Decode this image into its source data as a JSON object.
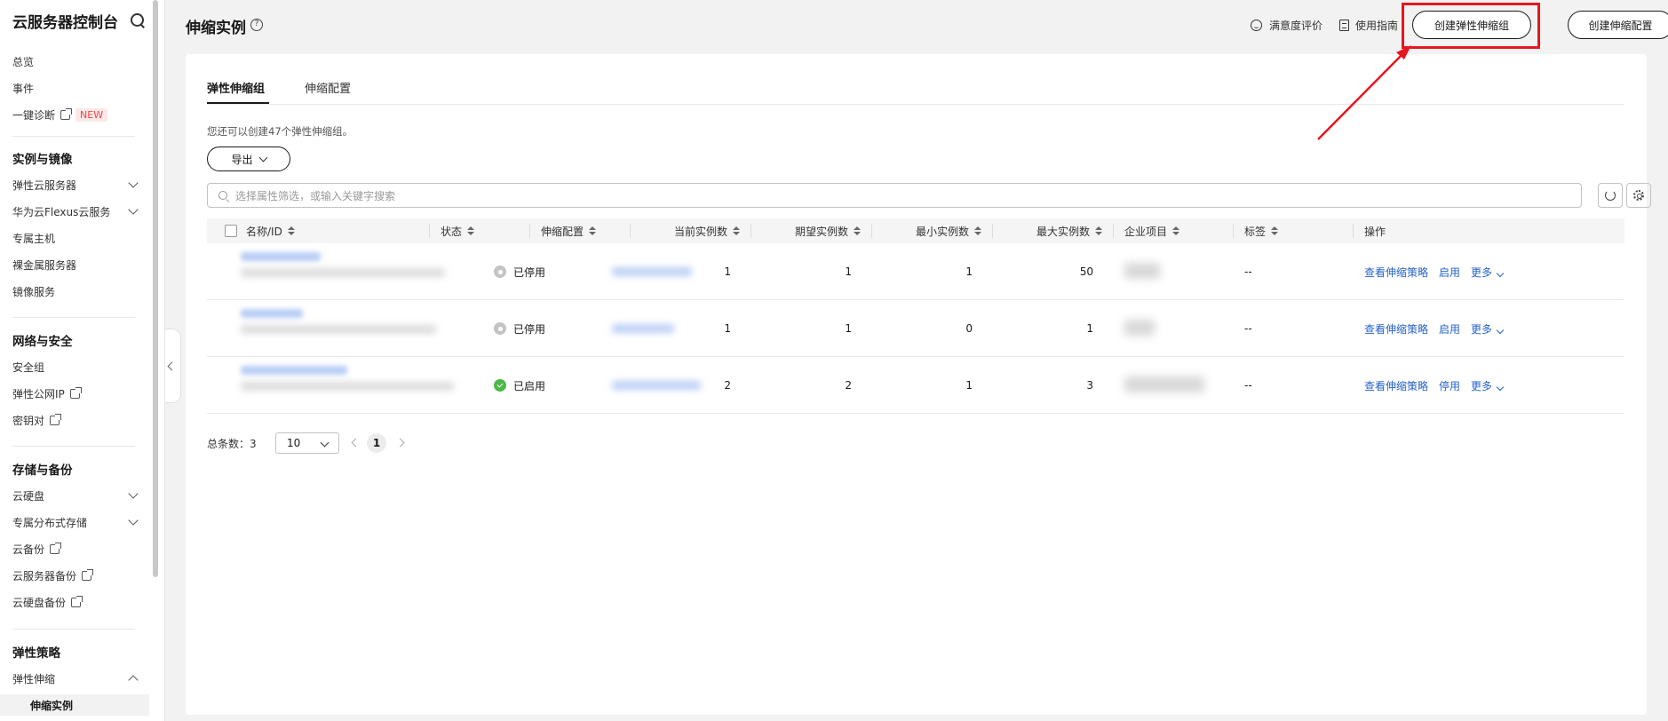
{
  "sidebar": {
    "title": "云服务器控制台",
    "items_top": [
      "总览",
      "事件",
      "一键诊断"
    ],
    "new_badge": "NEW",
    "groups": [
      {
        "title": "实例与镜像",
        "items": [
          "弹性云服务器",
          "华为云Flexus云服务",
          "专属主机",
          "裸金属服务器",
          "镜像服务"
        ]
      },
      {
        "title": "网络与安全",
        "items": [
          "安全组",
          "弹性公网IP",
          "密钥对"
        ]
      },
      {
        "title": "存储与备份",
        "items": [
          "云硬盘",
          "专属分布式存储",
          "云备份",
          "云服务器备份",
          "云硬盘备份"
        ]
      },
      {
        "title": "弹性策略",
        "items": [
          "弹性伸缩",
          "伸缩实例"
        ]
      }
    ]
  },
  "header": {
    "title": "伸缩实例",
    "help": "?",
    "satisfaction": "满意度评价",
    "guide": "使用指南",
    "create_group": "创建弹性伸缩组",
    "create_config": "创建伸缩配置"
  },
  "tabs": [
    "弹性伸缩组",
    "伸缩配置"
  ],
  "hint": "您还可以创建47个弹性伸缩组。",
  "export_label": "导出",
  "search_placeholder": "选择属性筛选，或输入关键字搜索",
  "table": {
    "columns": [
      "名称/ID",
      "状态",
      "伸缩配置",
      "当前实例数",
      "期望实例数",
      "最小实例数",
      "最大实例数",
      "企业项目",
      "标签",
      "操作"
    ],
    "rows": [
      {
        "status": "已停用",
        "state": "off",
        "current": "1",
        "desired": "1",
        "min": "1",
        "max": "50",
        "tags": "--",
        "op1": "查看伸缩策略",
        "op2": "启用",
        "op3": "更多"
      },
      {
        "status": "已停用",
        "state": "off",
        "current": "1",
        "desired": "1",
        "min": "0",
        "max": "1",
        "tags": "--",
        "op1": "查看伸缩策略",
        "op2": "启用",
        "op3": "更多"
      },
      {
        "status": "已启用",
        "state": "on",
        "current": "2",
        "desired": "2",
        "min": "1",
        "max": "3",
        "tags": "--",
        "op1": "查看伸缩策略",
        "op2": "停用",
        "op3": "更多"
      }
    ]
  },
  "pagination": {
    "total_label": "总条数：3",
    "page_size": "10",
    "current_page": "1"
  },
  "colors": {
    "link": "#2563c9",
    "highlight": "#e8161e",
    "status_on": "#4cb848",
    "status_off": "#c4c4c4"
  }
}
